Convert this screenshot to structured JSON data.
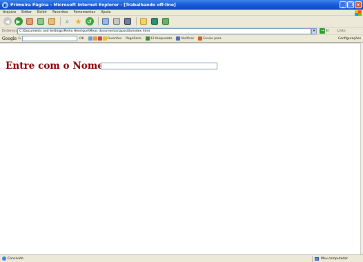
{
  "window": {
    "title": "Primeira Página - Microsoft Internet Explorer - [Trabalhando off-line]",
    "controls": {
      "minimize": "_",
      "restore": "❐",
      "close": "×"
    }
  },
  "menu": {
    "items": [
      "Arquivo",
      "Editar",
      "Exibir",
      "Favoritos",
      "Ferramentas",
      "Ajuda"
    ]
  },
  "toolbar": {
    "icons": [
      "back-icon",
      "forward-icon",
      "stop-icon",
      "refresh-icon",
      "home-icon",
      "search-icon",
      "favorites-icon",
      "history-icon",
      "mail-icon",
      "print-icon",
      "edit-icon",
      "folder-icon",
      "messenger-icon"
    ]
  },
  "address": {
    "label": "Endereço",
    "value": "C:\\Documents and Settings\\Pedro Henrique\\Meus documentos\\apostila\\index.html",
    "go_label": "Ir",
    "links_label": "Links"
  },
  "googlebar": {
    "logo": "Google",
    "letter": "G",
    "items": [
      "OK",
      "Favoritos",
      "PageRank",
      "12 bloqueado",
      "Verificar",
      "Enviar para"
    ],
    "config": "Configurações"
  },
  "content": {
    "label": "Entre com o Nome:",
    "input_value": ""
  },
  "status": {
    "left": "Concluído",
    "zone": "Meu computador"
  },
  "colors": {
    "title_bar": "#0a46c6",
    "label_color": "#800000",
    "chrome": "#ece9d8"
  }
}
